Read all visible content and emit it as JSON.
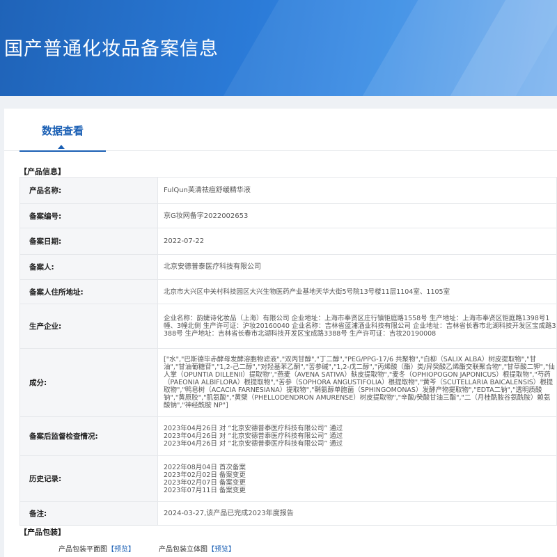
{
  "banner": {
    "title": "国产普通化妆品备案信息"
  },
  "tabs": [
    {
      "label": "数据查看"
    }
  ],
  "product_info": {
    "section_title": "【产品信息】",
    "rows": [
      {
        "label": "产品名称:",
        "value": "FulQun芙清祛痘舒缓精华液"
      },
      {
        "label": "备案编号:",
        "value": "京G妆网备字2022002653"
      },
      {
        "label": "备案日期:",
        "value": "2022-07-22"
      },
      {
        "label": "备案人:",
        "value": "北京安德普泰医疗科技有限公司"
      },
      {
        "label": "备案人住所地址:",
        "value": "北京市大兴区中关村科技园区大兴生物医药产业基地天华大街5号院13号楼11层1104室、1105室"
      },
      {
        "label": "生产企业:",
        "value": "企业名称：韵婕诗化妆品（上海）有限公司 企业地址：上海市奉贤区庄行镇钜庭路1558号 生产地址：上海市奉贤区钜庭路1398号1幢、3幢北侧 生产许可证：沪妆20160040 企业名称：吉林省蓝浦酒业科技有限公司 企业地址：吉林省长春市北湖科技开发区宝成路3388号 生产地址：吉林省长春市北湖科技开发区宝成路3388号 生产许可证：吉妆20190008"
      },
      {
        "label": "成分:",
        "value": "[\"水\",\"巴斯德毕赤酵母发酵溶胞物滤液\",\"双丙甘醇\",\"丁二醇\",\"PEG/PPG-17/6 共聚物\",\"白柳（SALIX ALBA）树皮提取物\",\"甘油\",\"甘油葡糖苷\",\"1,2-己二醇\",\"对羟基苯乙酮\",\"苦参碱\",\"1,2-戊二醇\",\"丙烯酸（酯）类/异癸酸乙烯酯交联聚合物\",\"甘草酸二钾\",\"仙人掌（OPUNTIA DILLENII）提取物\",\"燕麦（AVENA SATIVA）麸皮提取物\",\"麦冬（OPHIOPOGON JAPONICUS）根提取物\",\"芍药（PAEONIA ALBIFLORA）根提取物\",\"苦参（SOPHORA ANGUSTIFOLIA）根提取物\",\"黄芩（SCUTELLARIA BAICALENSIS）根提取物\",\"鸭皂树（ACACIA FARNESIANA）提取物\",\"鞘氨醇单胞菌（SPHINGOMONAS）发酵产物提取物\",\"EDTA二钠\",\"透明质酸钠\",\"黄原胶\",\"肌氨酸\",\"黄檗（PHELLODENDRON AMURENSE）树皮提取物\",\"辛酸/癸酸甘油三酯\",\"二（月桂酰胺谷氨酰胺）赖氨酸钠\",\"神经酰胺 NP\"]"
      },
      {
        "label": "备案后监督检查情况:",
        "lines": [
          "2023年04月26日 对 “北京安德普泰医疗科技有限公司” 通过",
          "2023年04月26日 对 “北京安德普泰医疗科技有限公司” 通过",
          "2023年04月26日 对 “北京安德普泰医疗科技有限公司” 通过"
        ]
      },
      {
        "label": "历史记录:",
        "lines": [
          "2022年08月04日 首次备案",
          "2023年02月02日 备案变更",
          "2023年02月07日 备案变更",
          "2023年07月11日 备案变更"
        ]
      },
      {
        "label": "备注:",
        "value": "2024-03-27,该产品已完成2023年度报告"
      }
    ]
  },
  "packaging": {
    "section_title": "【产品包装】",
    "items": [
      {
        "label": "产品包装平面图",
        "link": "【预览】"
      },
      {
        "label": "产品包装立体图",
        "link": "【预览】"
      }
    ]
  }
}
